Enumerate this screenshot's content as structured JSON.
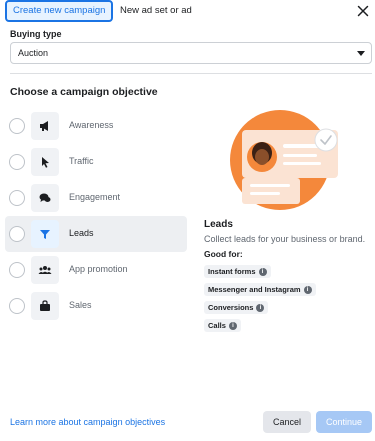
{
  "tabs": {
    "create": "Create new campaign",
    "existing": "New ad set or ad"
  },
  "close_icon": "close-icon",
  "buying_type": {
    "label": "Buying type",
    "value": "Auction"
  },
  "objective_heading": "Choose a campaign objective",
  "objectives": [
    {
      "label": "Awareness",
      "icon": "megaphone-icon",
      "selected": false
    },
    {
      "label": "Traffic",
      "icon": "cursor-icon",
      "selected": false
    },
    {
      "label": "Engagement",
      "icon": "chat-bubbles-icon",
      "selected": false
    },
    {
      "label": "Leads",
      "icon": "funnel-icon",
      "selected": true
    },
    {
      "label": "App promotion",
      "icon": "people-icon",
      "selected": false
    },
    {
      "label": "Sales",
      "icon": "shopping-bag-icon",
      "selected": false
    }
  ],
  "detail": {
    "title": "Leads",
    "description": "Collect leads for your business or brand.",
    "good_for_label": "Good for:",
    "tags": [
      "Instant forms",
      "Messenger and Instagram",
      "Conversions",
      "Calls"
    ]
  },
  "footer": {
    "learn_more": "Learn more about campaign objectives",
    "cancel": "Cancel",
    "continue": "Continue"
  },
  "colors": {
    "accent": "#1b74e4",
    "illustration_orange": "#f4883b",
    "selected_bg": "#edeff2"
  }
}
